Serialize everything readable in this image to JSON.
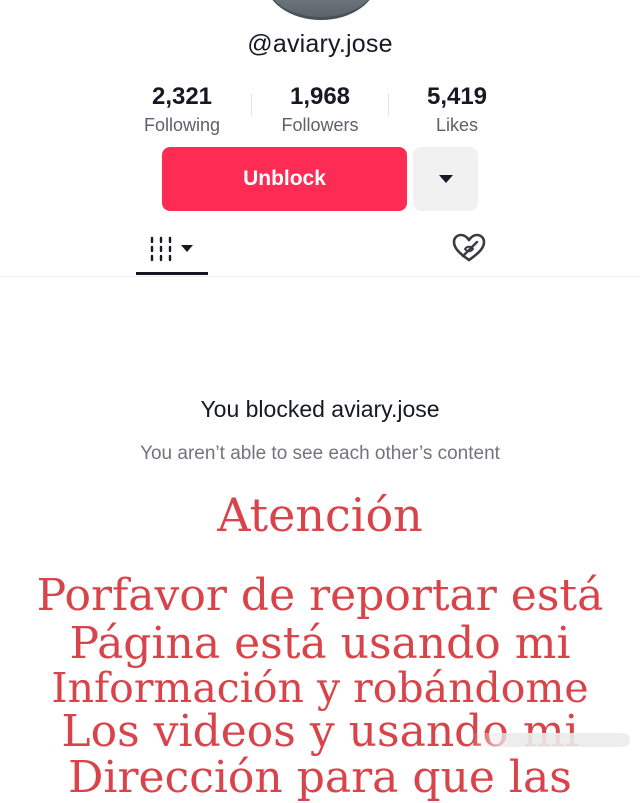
{
  "profile": {
    "username": "@aviary.jose"
  },
  "stats": [
    {
      "value": "2,321",
      "label": "Following"
    },
    {
      "value": "1,968",
      "label": "Followers"
    },
    {
      "value": "5,419",
      "label": "Likes"
    }
  ],
  "actions": {
    "unblock_label": "Unblock",
    "more_icon": "caret-down-icon"
  },
  "tabs": {
    "videos_icon": "grid-dropdown-icon",
    "liked_icon": "hidden-heart-icon"
  },
  "blocked": {
    "title": "You blocked aviary.jose",
    "subtitle": "You aren’t able to see each other’s content"
  },
  "overlay_note": {
    "heading": "Atención",
    "lines": [
      "Porfavor de reportar está",
      "Página está usando mi",
      "Información y robándome",
      "Los videos y usando mi",
      "Dirección para que las"
    ],
    "color": "#d9434a"
  },
  "colors": {
    "accent": "#fe2c55",
    "text_primary": "#161823",
    "text_secondary": "#73747b"
  }
}
